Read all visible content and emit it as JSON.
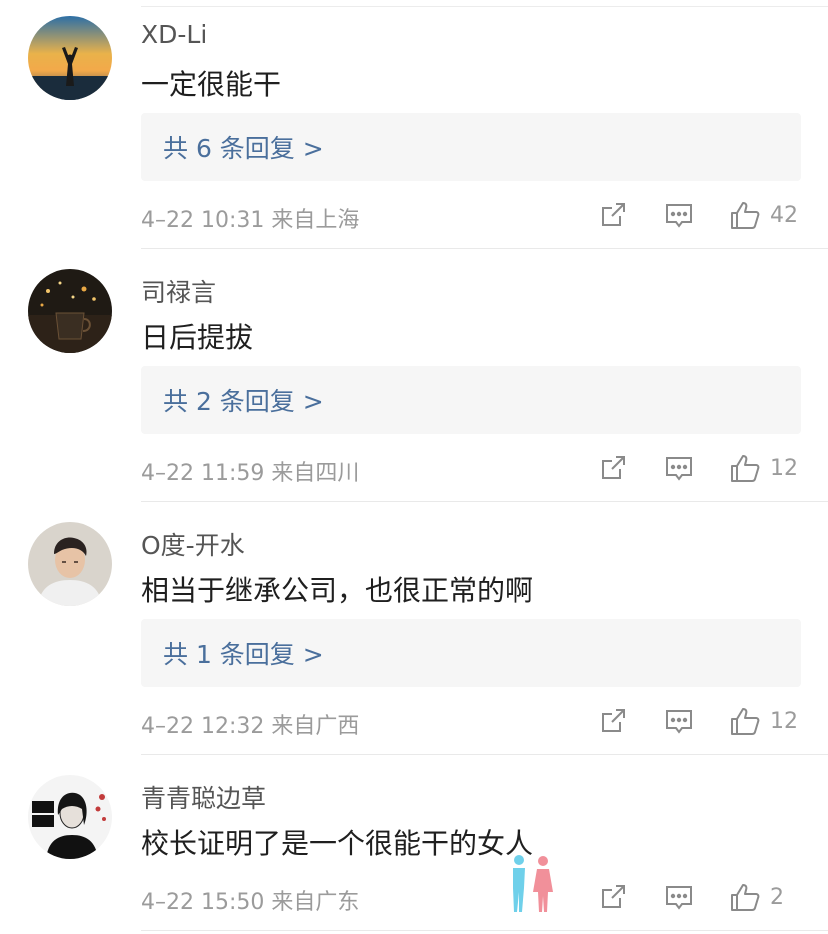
{
  "comments": [
    {
      "username": "XD-Li",
      "text": "一定很能干",
      "replies_label": "共 6 条回复 >",
      "meta": "4–22 10:31  来自上海",
      "likes": "42",
      "avatar_icon": "sunset-silhouette-avatar"
    },
    {
      "username": "司禄言",
      "text": "日后提拔",
      "replies_label": "共 2 条回复 >",
      "meta": "4–22 11:59  来自四川",
      "likes": "12",
      "avatar_icon": "night-cup-avatar"
    },
    {
      "username": "O度-开水",
      "text": "相当于继承公司，也很正常的啊",
      "replies_label": "共 1 条回复 >",
      "meta": "4–22 12:32  来自广西",
      "likes": "12",
      "avatar_icon": "portrait-avatar"
    },
    {
      "username": "青青聪边草",
      "text": "校长证明了是一个很能干的女人",
      "replies_label": "",
      "meta": "4–22 15:50  来自广东",
      "likes": "2",
      "avatar_icon": "black-white-portrait-avatar"
    }
  ],
  "colors": {
    "reply_link": "#4a6f9c",
    "meta_gray": "#9b9b9b",
    "reply_box": "#f6f6f6"
  }
}
